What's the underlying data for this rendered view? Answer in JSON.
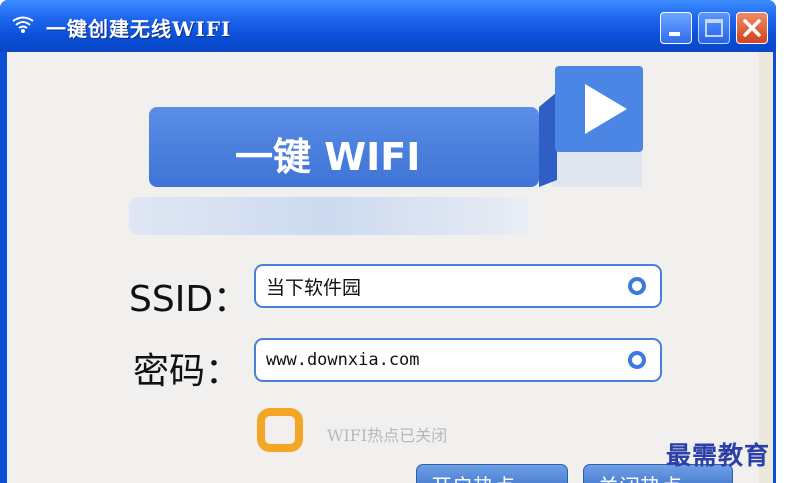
{
  "window": {
    "title": "一键创建无线WIFI",
    "controls": {
      "minimize": "minimize",
      "maximize": "maximize",
      "close": "close"
    }
  },
  "banner": {
    "text": "一键 WIFI"
  },
  "form": {
    "ssid_label": "SSID：",
    "ssid_value": "当下软件园",
    "password_label": "密码：",
    "password_value": "www.downxia.com"
  },
  "status": {
    "text": "WIFI热点已关闭"
  },
  "buttons": {
    "open_hotspot": "开启热点",
    "close_hotspot": "关闭热点"
  },
  "watermark": {
    "text": "最需教育"
  },
  "colors": {
    "titlebar": "#0a4fd6",
    "accent_blue": "#3d7ae0",
    "status_orange": "#f2a623",
    "close_red": "#d2431e"
  }
}
